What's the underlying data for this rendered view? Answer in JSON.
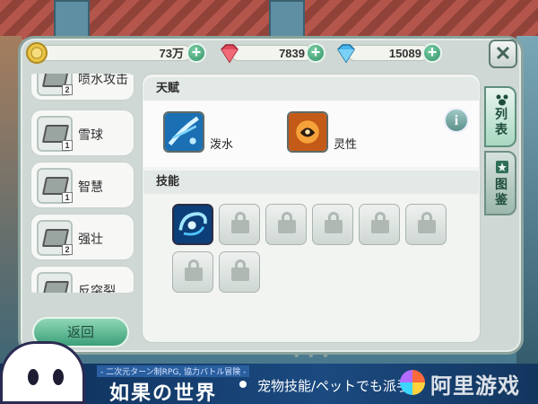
{
  "resources": {
    "gold": {
      "value": "73万",
      "icon": "gold-coin-icon",
      "color": "#e8c547"
    },
    "red_gem": {
      "value": "7839",
      "icon": "red-diamond-icon",
      "color": "#e04a5a"
    },
    "blue_gem": {
      "value": "15089",
      "icon": "blue-diamond-icon",
      "color": "#46b4ec"
    },
    "plus_label": "+"
  },
  "close_label": "✕",
  "skill_list": [
    {
      "name": "喷水攻击",
      "level": "2"
    },
    {
      "name": "雪球",
      "level": "1"
    },
    {
      "name": "智慧",
      "level": "1"
    },
    {
      "name": "强壮",
      "level": "2"
    },
    {
      "name": "反突裂",
      "level": ""
    }
  ],
  "back_label": "返回",
  "talent": {
    "heading": "天赋",
    "items": [
      {
        "name": "泼水",
        "icon": "water-splash-icon"
      },
      {
        "name": "灵性",
        "icon": "spirit-icon"
      }
    ],
    "info_label": "i"
  },
  "skills": {
    "heading": "技能",
    "unlocked": [
      {
        "icon": "water-swirl-icon"
      }
    ],
    "locked_count": 7
  },
  "page_dots": "• • •",
  "tabs": [
    {
      "label": "列表",
      "icon": "paw-icon",
      "active": true
    },
    {
      "label": "图鉴",
      "icon": "star-book-icon",
      "active": false
    }
  ],
  "banner": {
    "subtitle": "- 二次元ターン制RPG, 協力バトル冒険 -",
    "title": "如果の世界",
    "text": "宠物技能/ペットでも派手",
    "watermark": "阿里游戏"
  }
}
